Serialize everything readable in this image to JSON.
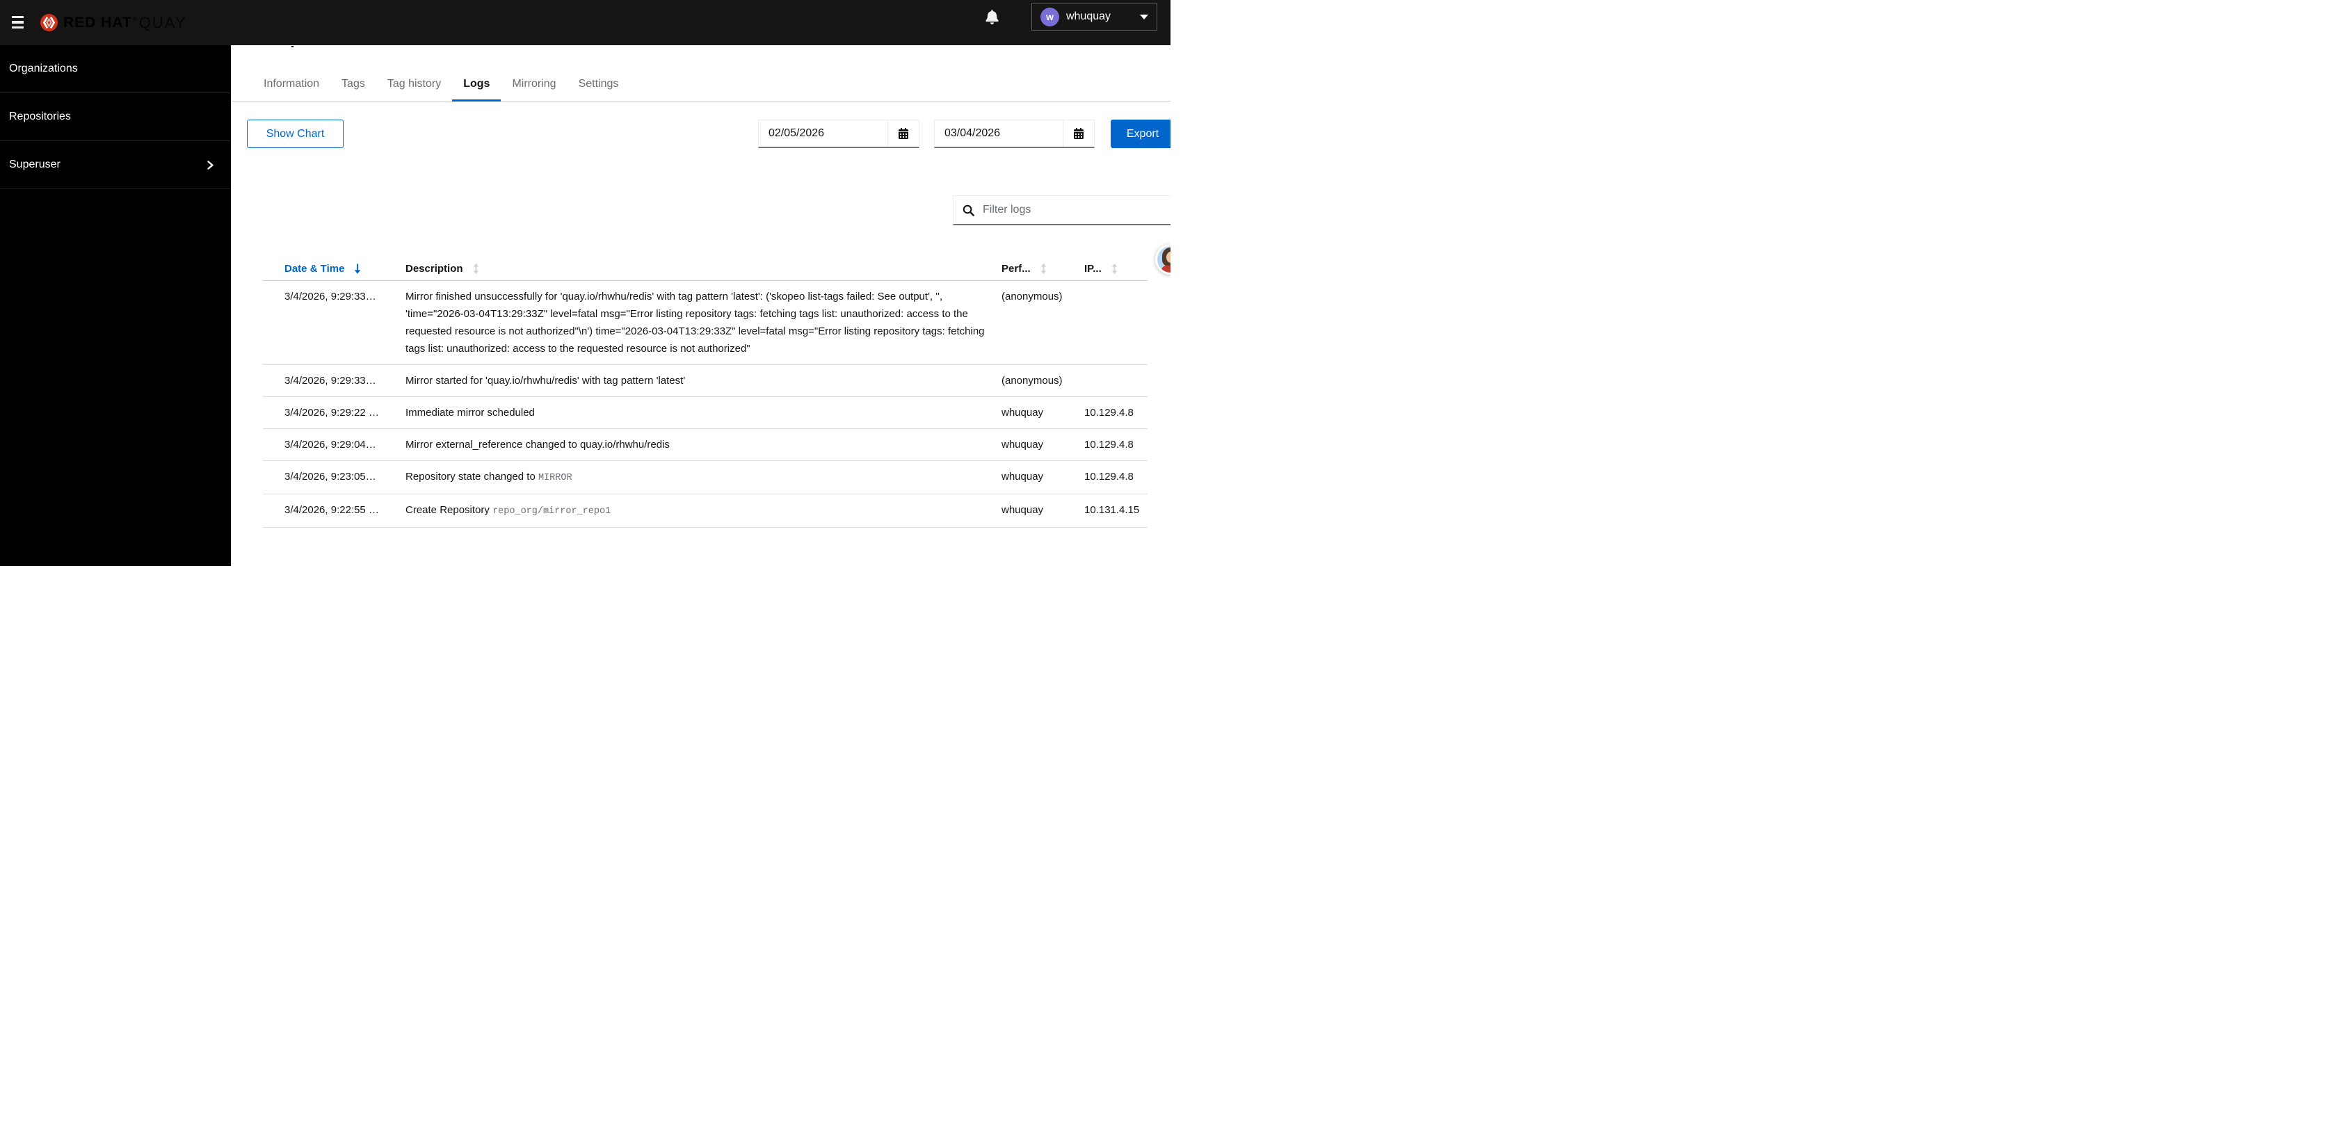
{
  "colors": {
    "accent_blue": "#0066cc",
    "topbar_bg": "#151515",
    "sidebar_bg": "#000000",
    "brand_red": "#d0331b",
    "avatar_purple": "#7a6fd9",
    "inactive_gray": "#6a6e73"
  },
  "topbar": {
    "brand_red_hat": "RED HAT",
    "brand_registered": "®",
    "brand_quay": "QUAY",
    "user": {
      "initial": "w",
      "name": "whuquay"
    }
  },
  "sidebar": {
    "items": [
      {
        "label": "Organizations",
        "has_chevron": false
      },
      {
        "label": "Repositories",
        "has_chevron": false
      },
      {
        "label": "Superuser",
        "has_chevron": true
      }
    ]
  },
  "tabs": {
    "items": [
      {
        "label": "Information",
        "active": false
      },
      {
        "label": "Tags",
        "active": false
      },
      {
        "label": "Tag history",
        "active": false
      },
      {
        "label": "Logs",
        "active": true
      },
      {
        "label": "Mirroring",
        "active": false
      },
      {
        "label": "Settings",
        "active": false
      }
    ]
  },
  "toolbar": {
    "show_chart_label": "Show Chart",
    "date_from": "02/05/2026",
    "date_to": "03/04/2026",
    "export_label": "Export"
  },
  "filter": {
    "placeholder": "Filter logs"
  },
  "table": {
    "columns": [
      {
        "label": "Date & Time",
        "sort": "desc"
      },
      {
        "label": "Description",
        "sort": "sortable"
      },
      {
        "label": "Perf...",
        "sort": "sortable"
      },
      {
        "label": "IP...",
        "sort": "sortable"
      }
    ],
    "rows": [
      {
        "datetime": "3/4/2026, 9:29:33…",
        "description": "Mirror finished unsuccessfully for 'quay.io/rhwhu/redis' with tag pattern 'latest': ('skopeo list-tags failed: See output', '', 'time=\"2026-03-04T13:29:33Z\" level=fatal msg=\"Error listing repository tags: fetching tags list: unauthorized: access to the requested resource is not authorized\"\\n') time=\"2026-03-04T13:29:33Z\" level=fatal msg=\"Error listing repository tags: fetching tags list: unauthorized: access to the requested resource is not authorized\"",
        "description_mono": "",
        "performed_by": "(anonymous)",
        "ip": ""
      },
      {
        "datetime": "3/4/2026, 9:29:33…",
        "description": "Mirror started for 'quay.io/rhwhu/redis' with tag pattern 'latest'",
        "description_mono": "",
        "performed_by": "(anonymous)",
        "ip": ""
      },
      {
        "datetime": "3/4/2026, 9:29:22 …",
        "description": "Immediate mirror scheduled",
        "description_mono": "",
        "performed_by": "whuquay",
        "ip": "10.129.4.8"
      },
      {
        "datetime": "3/4/2026, 9:29:04…",
        "description": "Mirror external_reference changed to quay.io/rhwhu/redis",
        "description_mono": "",
        "performed_by": "whuquay",
        "ip": "10.129.4.8"
      },
      {
        "datetime": "3/4/2026, 9:23:05…",
        "description": "Repository state changed to ",
        "description_mono": "MIRROR",
        "performed_by": "whuquay",
        "ip": "10.129.4.8"
      },
      {
        "datetime": "3/4/2026, 9:22:55 …",
        "description": "Create Repository ",
        "description_mono": "repo_org/mirror_repo1",
        "performed_by": "whuquay",
        "ip": "10.131.4.15"
      }
    ]
  }
}
